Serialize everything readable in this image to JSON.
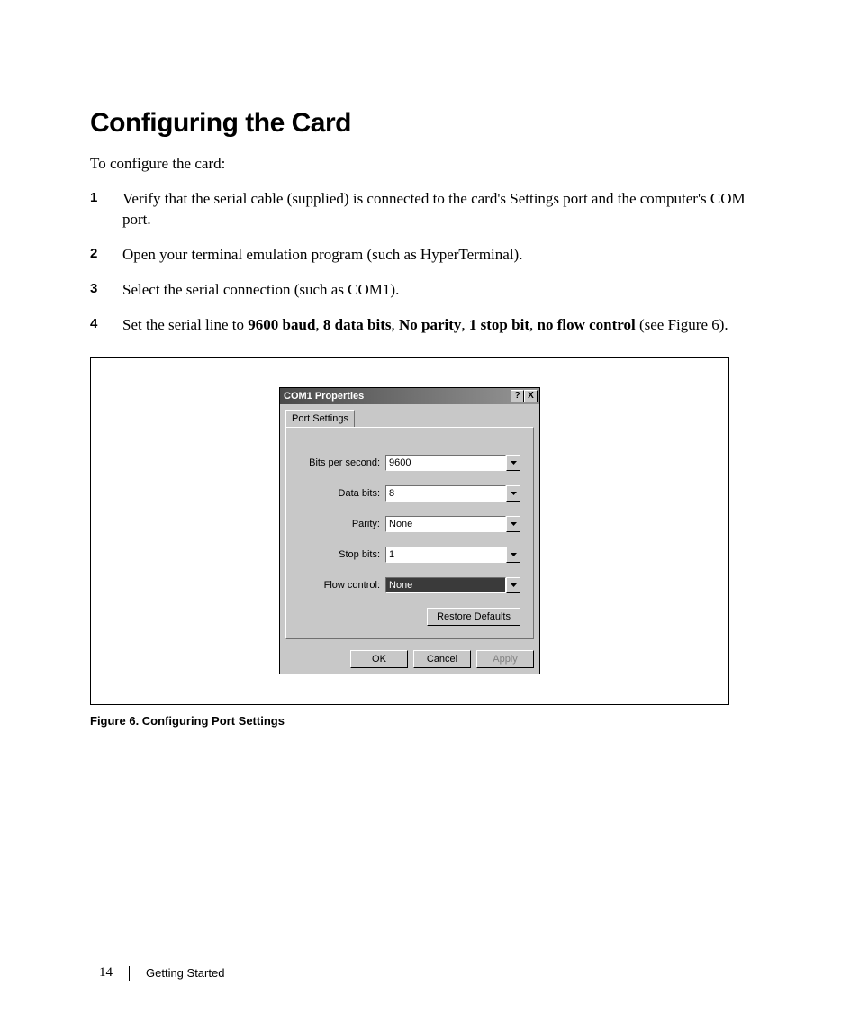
{
  "heading": "Configuring the Card",
  "intro": "To configure the card:",
  "steps": [
    {
      "text": "Verify that the serial cable (supplied) is connected to the card's Settings port and the computer's COM port."
    },
    {
      "text": "Open your terminal emulation program (such as HyperTerminal)."
    },
    {
      "text": "Select the serial connection (such as COM1)."
    },
    {
      "prefix": "Set the serial line to ",
      "bolds": [
        "9600 baud",
        ", ",
        "8 data bits",
        ", ",
        "No parity",
        ", ",
        "1 stop bit",
        ", ",
        "no flow control"
      ],
      "suffix": " (see Figure 6)."
    }
  ],
  "dialog": {
    "title": "COM1 Properties",
    "help": "?",
    "close": "X",
    "tab": "Port Settings",
    "fields": [
      {
        "label": "Bits per second:",
        "value": "9600",
        "selected": false
      },
      {
        "label": "Data bits:",
        "value": "8",
        "selected": false
      },
      {
        "label": "Parity:",
        "value": "None",
        "selected": false
      },
      {
        "label": "Stop bits:",
        "value": "1",
        "selected": false
      },
      {
        "label": "Flow control:",
        "value": "None",
        "selected": true
      }
    ],
    "restore": "Restore Defaults",
    "ok": "OK",
    "cancel": "Cancel",
    "apply": "Apply"
  },
  "figure_caption": "Figure 6. Configuring Port Settings",
  "footer": {
    "page": "14",
    "section": "Getting Started"
  }
}
